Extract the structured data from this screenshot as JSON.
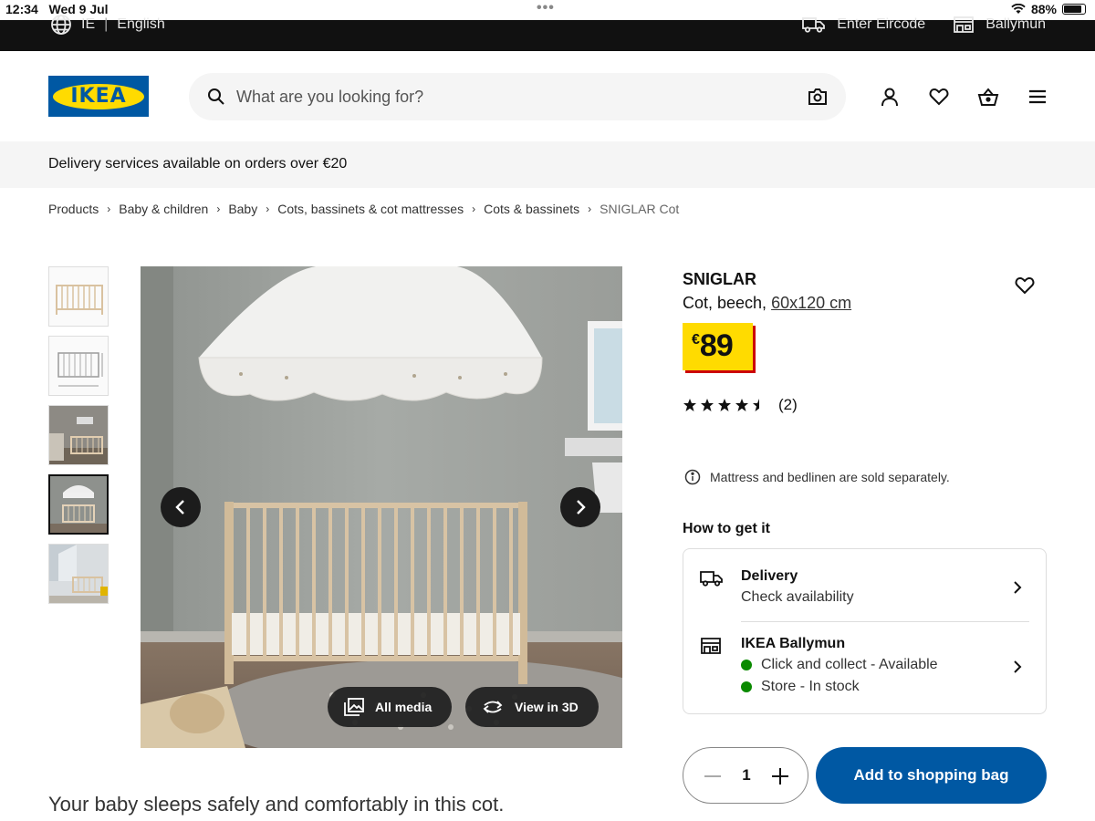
{
  "status_bar": {
    "time": "12:34",
    "date": "Wed 9 Jul",
    "wifi": "wifi-icon",
    "battery_percent": "88%",
    "battery_level": 0.88
  },
  "top_bar": {
    "country": "IE",
    "language": "English",
    "eircode": "Enter Eircode",
    "store": "Ballymun"
  },
  "header": {
    "logo_text": "IKEA",
    "search_placeholder": "What are you looking for?"
  },
  "delivery_strip": "Delivery services available on orders over €20",
  "breadcrumb": [
    "Products",
    "Baby & children",
    "Baby",
    "Cots, bassinets & cot mattresses",
    "Cots & bassinets",
    "SNIGLAR Cot"
  ],
  "media": {
    "all_media": "All media",
    "view_3d": "View in 3D",
    "thumbnail_count": 5,
    "active_thumbnail": 4
  },
  "product": {
    "name": "SNIGLAR",
    "description": "Cot, beech, ",
    "size": "60x120 cm",
    "currency": "€",
    "price": "89",
    "rating": 4.5,
    "review_count": "(2)",
    "note": "Mattress and bedlinen are sold separately."
  },
  "how_to_get": {
    "title": "How to get it",
    "delivery_title": "Delivery",
    "delivery_sub": "Check availability",
    "store_title": "IKEA Ballymun",
    "click_collect": "Click and collect - Available",
    "store_stock": "Store - In stock"
  },
  "purchase": {
    "quantity": "1",
    "add_label": "Add to shopping bag"
  },
  "tagline": "Your baby sleeps safely and comfortably in this cot.",
  "colors": {
    "ikea_blue": "#0058a3",
    "ikea_yellow": "#ffdb00",
    "price_shadow": "#cc0008",
    "available_green": "#0a8a00"
  }
}
